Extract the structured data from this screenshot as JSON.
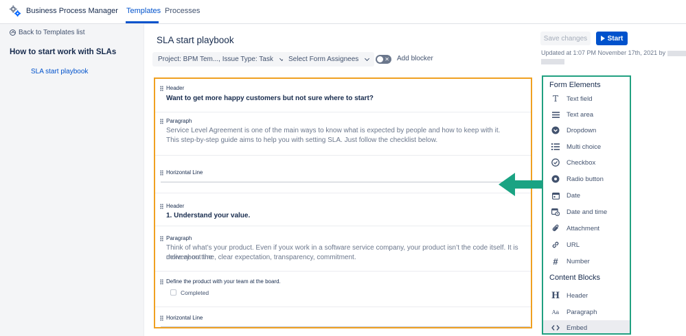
{
  "app": {
    "name": "Business Process Manager",
    "logo_icon": "gears-icon"
  },
  "nav": {
    "tabs": [
      {
        "label": "Templates",
        "active": true
      },
      {
        "label": "Processes",
        "active": false
      }
    ]
  },
  "sidebar": {
    "back_label": "Back to Templates list",
    "section_title": "How to start work with SLAs",
    "items": [
      {
        "label": "SLA start playbook",
        "active": true
      }
    ]
  },
  "page": {
    "title": "SLA start playbook",
    "project_select": "Project: BPM Tem..., Issue Type: Task",
    "assignee_select": "Select Form Assignees",
    "add_blocker_label": "Add blocker",
    "add_blocker_on": false,
    "save_label": "Save changes",
    "start_label": "Start",
    "updated_text": "Updated at 1:07 PM November 17th, 2021 by"
  },
  "form": {
    "blocks": [
      {
        "type": "Header",
        "label": "Header",
        "text": "Want to get more happy customers but not sure where to start?"
      },
      {
        "type": "Paragraph",
        "label": "Paragraph",
        "lines": [
          "Service Level Agreement is one of the main ways to know what is expected by people and how to keep with it.",
          "This step-by-step guide aims to help you with setting SLA. Just follow the checklist below."
        ]
      },
      {
        "type": "Horizontal Line",
        "label": "Horizontal Line"
      },
      {
        "type": "Header",
        "label": "Header",
        "text": "1. Understand your value."
      },
      {
        "type": "Paragraph",
        "label": "Paragraph",
        "lines": [
          "Think of what’s your product. Even if youx work in a software service company, your product isn’t the code itself. It is more about the",
          "delivery on time, clear expectation, transparency, commitment."
        ]
      },
      {
        "type": "Checkbox",
        "label": "Define the product with your team at the board.",
        "option": "Completed",
        "checked": false
      },
      {
        "type": "Horizontal Line",
        "label": "Horizontal Line"
      }
    ]
  },
  "panel": {
    "form_elements_title": "Form Elements",
    "form_elements": [
      {
        "label": "Text field",
        "icon": "text-field-icon"
      },
      {
        "label": "Text area",
        "icon": "text-area-icon"
      },
      {
        "label": "Dropdown",
        "icon": "dropdown-icon"
      },
      {
        "label": "Multi choice",
        "icon": "multi-choice-icon"
      },
      {
        "label": "Checkbox",
        "icon": "checkbox-icon"
      },
      {
        "label": "Radio button",
        "icon": "radio-button-icon"
      },
      {
        "label": "Date",
        "icon": "calendar-icon"
      },
      {
        "label": "Date and time",
        "icon": "calendar-clock-icon"
      },
      {
        "label": "Attachment",
        "icon": "paperclip-icon"
      },
      {
        "label": "URL",
        "icon": "link-icon"
      },
      {
        "label": "Number",
        "icon": "hash-icon"
      }
    ],
    "content_blocks_title": "Content Blocks",
    "content_blocks": [
      {
        "label": "Header",
        "icon": "header-icon"
      },
      {
        "label": "Paragraph",
        "icon": "paragraph-icon"
      },
      {
        "label": "Embed",
        "icon": "embed-code-icon",
        "highlighted": true
      }
    ]
  },
  "colors": {
    "accent": "#0052cc",
    "canvas_outline": "#f0a020",
    "panel_outline": "#20a080",
    "arrow": "#1aa383"
  }
}
